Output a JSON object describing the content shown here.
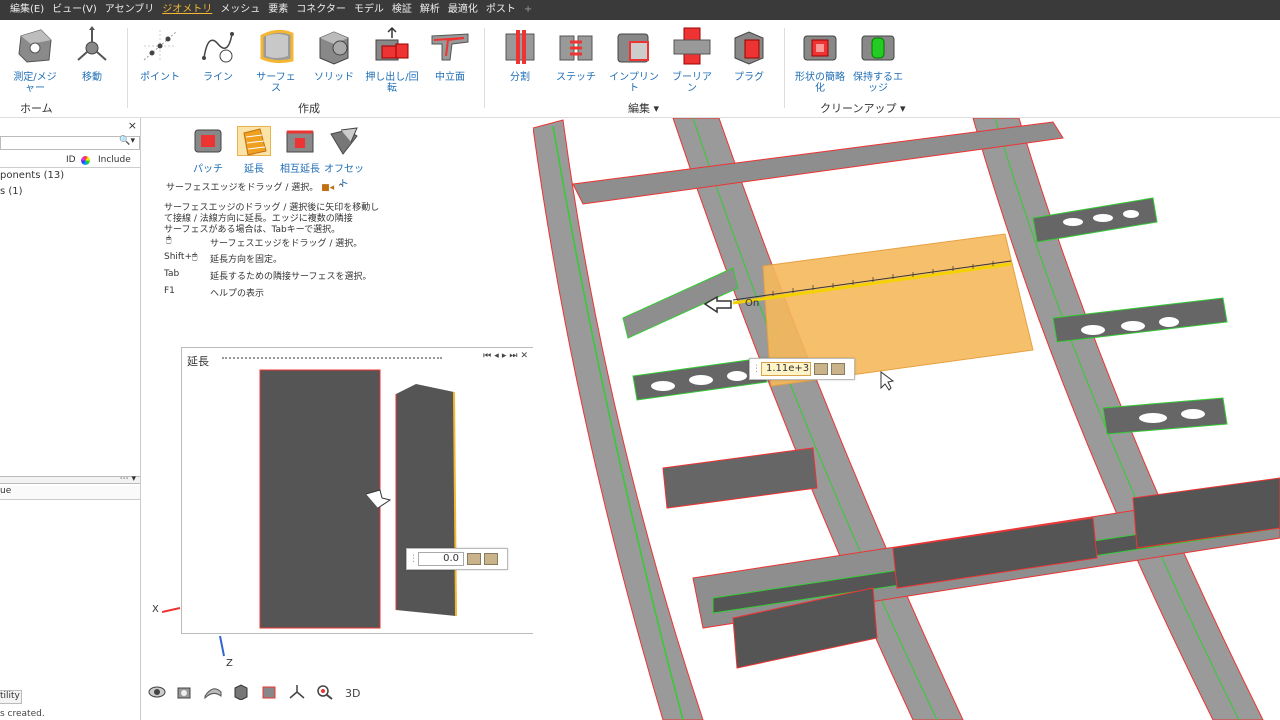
{
  "menu": {
    "items": [
      "編集(E)",
      "ビュー(V)",
      "アセンブリ",
      "ジオメトリ",
      "メッシュ",
      "要素",
      "コネクター",
      "モデル",
      "検証",
      "解析",
      "最適化",
      "ポスト",
      "+"
    ],
    "active": "ジオメトリ"
  },
  "ribbon": {
    "home": {
      "measure": "測定/メジャー",
      "move": "移動",
      "group": "ホーム"
    },
    "create": {
      "point": "ポイント",
      "line": "ライン",
      "surface": "サーフェス",
      "solid": "ソリッド",
      "extrude": "押し出し/回転",
      "midsurface": "中立面",
      "group": "作成"
    },
    "edit": {
      "split": "分割",
      "stitch": "ステッチ",
      "imprint": "インプリント",
      "boolean": "ブーリアン",
      "plug": "プラグ",
      "group": "編集"
    },
    "cleanup": {
      "simplify": "形状の簡略化",
      "keep_edge": "保持するエッジ",
      "group": "クリーンアップ"
    }
  },
  "left_panel": {
    "close": "×",
    "columns": {
      "id": "ID",
      "include": "Include"
    },
    "rows": [
      "ponents (13)",
      "s (1)"
    ],
    "lower_header": "ue",
    "tab": "tility",
    "status": "s created."
  },
  "subtools": [
    {
      "label": "パッチ",
      "icon": "patch-icon"
    },
    {
      "label": "延長",
      "icon": "extend-icon"
    },
    {
      "label": "相互延長",
      "icon": "mutual-extend-icon"
    },
    {
      "label": "オフセット",
      "icon": "offset-icon"
    }
  ],
  "help": {
    "line1": "サーフェスエッジをドラッグ / 選択。",
    "desc1": "サーフェスエッジのドラッグ / 選択後に矢印を移動し",
    "desc2": "て接線 / 法線方向に延長。エッジに複数の隣接",
    "desc3": "サーフェスがある場合は、Tabキーで選択。",
    "mouse_action": "サーフェスエッジをドラッグ / 選択。",
    "shift_key": "Shift+",
    "shift_action": "延長方向を固定。",
    "tab_key": "Tab",
    "tab_action": "延長するための隣接サーフェスを選択。",
    "f1_key": "F1",
    "f1_action": "ヘルプの表示"
  },
  "dialog": {
    "title": "延長",
    "value": "0.0"
  },
  "viewport": {
    "length_value": "1.11e+3",
    "marker_label": "On"
  },
  "axes": {
    "x": "X",
    "z": "Z"
  },
  "colors": {
    "accent": "#f3b733",
    "ribbon_text": "#1f6eb5",
    "highlight_surface": "#f5b85c"
  }
}
